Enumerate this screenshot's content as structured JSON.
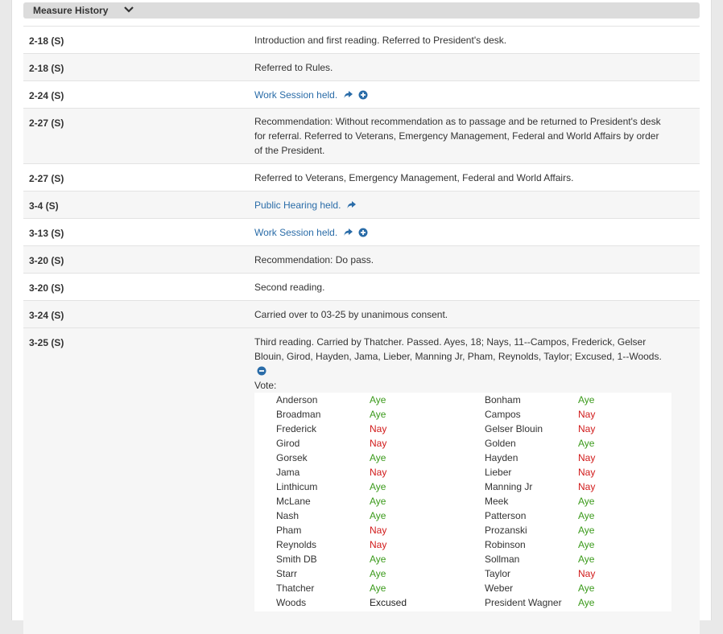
{
  "header": {
    "title": "Measure History"
  },
  "history": [
    {
      "date": "2-18 (S)",
      "text": "Introduction and first reading. Referred to President's desk."
    },
    {
      "date": "2-18 (S)",
      "text": "Referred to Rules."
    },
    {
      "date": "2-24 (S)",
      "text": "Work Session held."
    },
    {
      "date": "2-27 (S)",
      "text": "Recommendation: Without recommendation as to passage and be returned to President's desk for referral. Referred to Veterans, Emergency Management, Federal and World Affairs by order of the President."
    },
    {
      "date": "2-27 (S)",
      "text": "Referred to Veterans, Emergency Management, Federal and World Affairs."
    },
    {
      "date": "3-4 (S)",
      "text": "Public Hearing held."
    },
    {
      "date": "3-13 (S)",
      "text": "Work Session held."
    },
    {
      "date": "3-20 (S)",
      "text": "Recommendation: Do pass."
    },
    {
      "date": "3-20 (S)",
      "text": "Second reading."
    },
    {
      "date": "3-24 (S)",
      "text": "Carried over to 03-25 by unanimous consent."
    },
    {
      "date": "3-25 (S)",
      "text": "Third reading. Carried by Thatcher. Passed. Ayes, 18; Nays, 11--Campos, Frederick, Gelser Blouin, Girod, Hayden, Jama, Lieber, Manning Jr, Pham, Reynolds, Taylor; Excused, 1--Woods."
    }
  ],
  "vote_label": "Vote:",
  "votes": [
    [
      "Anderson",
      "Aye",
      "Bonham",
      "Aye"
    ],
    [
      "Broadman",
      "Aye",
      "Campos",
      "Nay"
    ],
    [
      "Frederick",
      "Nay",
      "Gelser Blouin",
      "Nay"
    ],
    [
      "Girod",
      "Nay",
      "Golden",
      "Aye"
    ],
    [
      "Gorsek",
      "Aye",
      "Hayden",
      "Nay"
    ],
    [
      "Jama",
      "Nay",
      "Lieber",
      "Nay"
    ],
    [
      "Linthicum",
      "Aye",
      "Manning Jr",
      "Nay"
    ],
    [
      "McLane",
      "Aye",
      "Meek",
      "Aye"
    ],
    [
      "Nash",
      "Aye",
      "Patterson",
      "Aye"
    ],
    [
      "Pham",
      "Nay",
      "Prozanski",
      "Aye"
    ],
    [
      "Reynolds",
      "Nay",
      "Robinson",
      "Aye"
    ],
    [
      "Smith DB",
      "Aye",
      "Sollman",
      "Aye"
    ],
    [
      "Starr",
      "Aye",
      "Taylor",
      "Nay"
    ],
    [
      "Thatcher",
      "Aye",
      "Weber",
      "Aye"
    ],
    [
      "Woods",
      "Excused",
      "President Wagner",
      "Aye"
    ]
  ],
  "colors": {
    "aye": "#3a9a1a",
    "nay": "#d11a1a",
    "link": "#2a6ca8"
  }
}
